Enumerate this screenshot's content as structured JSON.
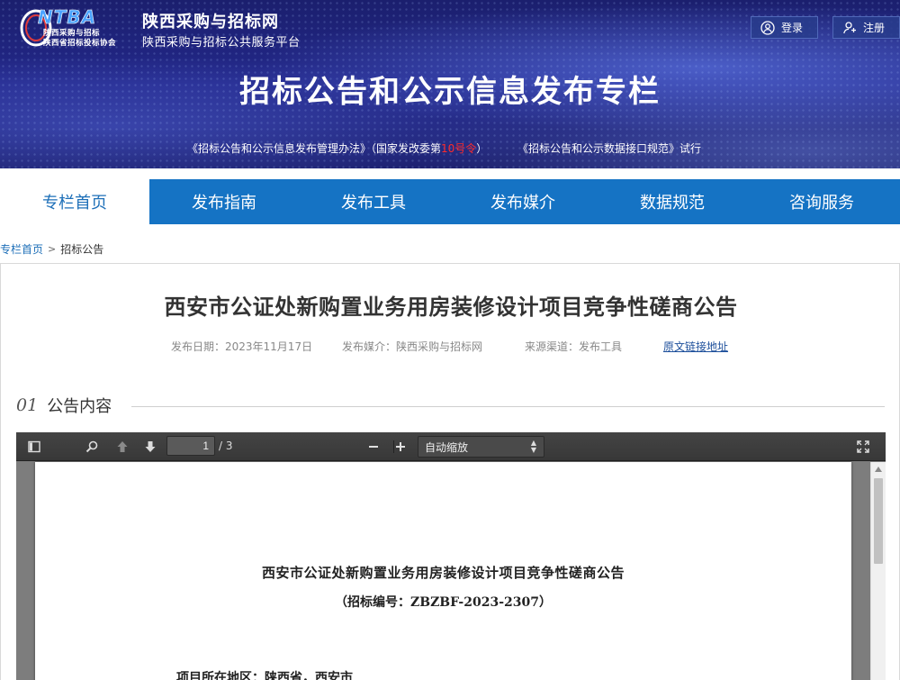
{
  "header": {
    "logo_text": "NTBA",
    "logo_sub1": "陕西采购与招标",
    "logo_sub2": "陕西省招标投标协会",
    "site_name": "陕西采购与招标网",
    "site_subtitle": "陕西采购与招标公共服务平台",
    "login_label": "登录",
    "register_label": "注册",
    "banner_title": "招标公告和公示信息发布专栏",
    "notice_1_pre": "《招标公告和公示信息发布管理办法》（国家发改委第",
    "notice_1_red": "10号令",
    "notice_1_post": "）",
    "notice_2": "《招标公告和公示数据接口规范》试行"
  },
  "nav": {
    "items": [
      {
        "label": "专栏首页",
        "active": true
      },
      {
        "label": "发布指南",
        "active": false
      },
      {
        "label": "发布工具",
        "active": false
      },
      {
        "label": "发布媒介",
        "active": false
      },
      {
        "label": "数据规范",
        "active": false
      },
      {
        "label": "咨询服务",
        "active": false
      }
    ]
  },
  "breadcrumb": {
    "home": "专栏首页",
    "separator": ">",
    "current": "招标公告"
  },
  "article": {
    "title": "西安市公证处新购置业务用房装修设计项目竞争性磋商公告",
    "publish_date": "发布日期：2023年11月17日",
    "publish_media": "发布媒介：陕西采购与招标网",
    "source_channel": "来源渠道：发布工具",
    "original_link": "原文链接地址"
  },
  "section": {
    "number": "01",
    "label": "公告内容"
  },
  "viewer": {
    "current_page": "1",
    "total_pages": "/ 3",
    "zoom_label": "自动缩放",
    "doc_title": "西安市公证处新购置业务用房装修设计项目竞争性磋商公告",
    "doc_code": "（招标编号：ZBZBF-2023-2307）",
    "doc_line_1": "项目所在地区：陕西省，西安市"
  },
  "colors": {
    "nav_blue": "#1573c4",
    "active_text": "#1d6fb8",
    "notice_red": "#ff2b2b",
    "banner_dark": "#1b1f6e"
  }
}
